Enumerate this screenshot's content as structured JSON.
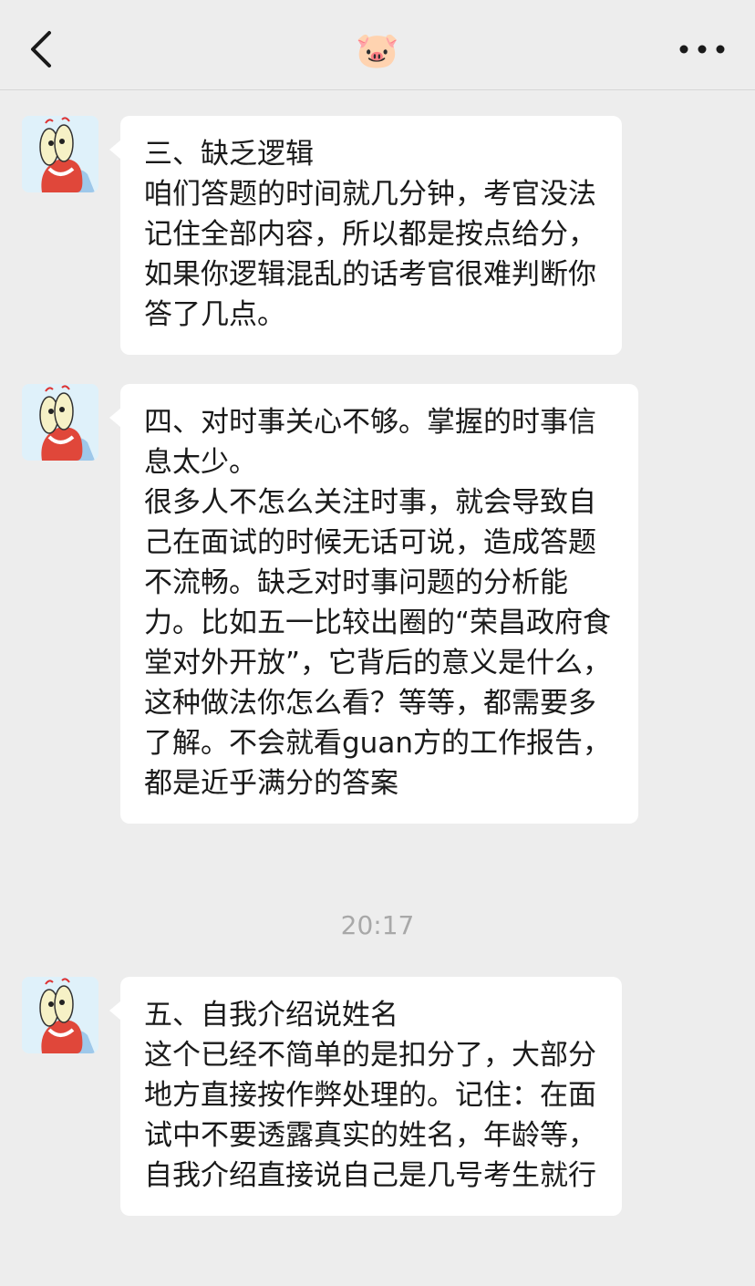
{
  "header": {
    "title": "🐷",
    "back_icon": "chevron-left-icon",
    "more_icon": "more-dots-icon"
  },
  "messages": [
    {
      "text": "三、缺乏逻辑\n咱们答题的时间就几分钟，考官没法记住全部内容，所以都是按点给分，如果你逻辑混乱的话考官很难判断你答了几点。"
    },
    {
      "text": "四、对时事关心不够。掌握的时事信息太少。\n很多人不怎么关注时事，就会导致自己在面试的时候无话可说，造成答题不流畅。缺乏对时事问题的分析能力。比如五一比较出圈的“荣昌政府食堂对外开放”，它背后的意义是什么，这种做法你怎么看？等等，都需要多了解。不会就看guan方的工作报告，都是近乎满分的答案"
    },
    {
      "text": "五、自我介绍说姓名\n这个已经不简单的是扣分了，大部分地方直接按作弊处理的。记住：在面试中不要透露真实的姓名，年龄等，自我介绍直接说自己是几号考生就行"
    }
  ],
  "timestamp": "20:17",
  "colors": {
    "background": "#ededed",
    "bubble": "#ffffff",
    "text": "#1a1a1a",
    "timestamp": "#a8a8a8"
  }
}
